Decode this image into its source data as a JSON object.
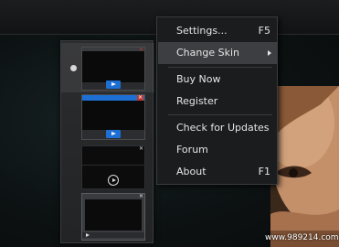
{
  "menu": {
    "items": [
      {
        "label": "Settings...",
        "shortcut": "F5"
      },
      {
        "label": "Change Skin",
        "shortcut": "",
        "submenu": true,
        "highlighted": true
      },
      {
        "label": "Buy Now",
        "shortcut": ""
      },
      {
        "label": "Register",
        "shortcut": ""
      },
      {
        "label": "Check for Updates",
        "shortcut": ""
      },
      {
        "label": "Forum",
        "shortcut": ""
      },
      {
        "label": "About",
        "shortcut": "F1"
      }
    ]
  },
  "skins": [
    {
      "selected": true,
      "style": "dark-blue-play"
    },
    {
      "selected": false,
      "style": "blue-title-blue-play"
    },
    {
      "selected": false,
      "style": "black-circle-play"
    },
    {
      "selected": false,
      "style": "grey-frame"
    }
  ],
  "colors": {
    "accent_blue": "#1d6fd4",
    "close_red": "#c0392b",
    "menu_bg": "#1b1c1e",
    "menu_highlight": "#3d3e42"
  },
  "watermark": "www.989214.com"
}
